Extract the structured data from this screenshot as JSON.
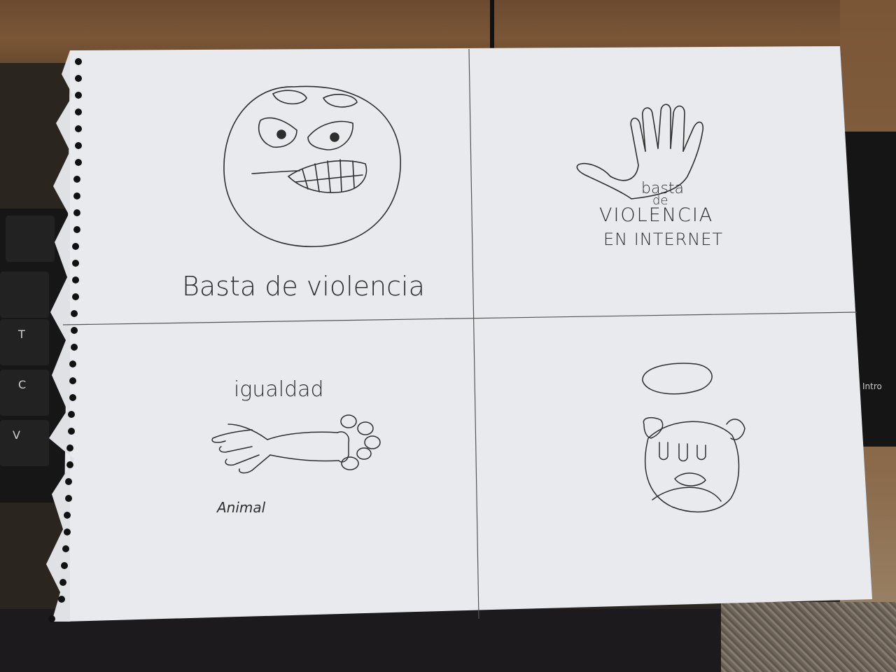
{
  "scene": {
    "description_colors": {
      "paper": "#e9ebee",
      "ink": "#2e2e2e",
      "desk": "#7a5636",
      "keyboard": "#161616"
    }
  },
  "keyboard": {
    "left_keys": [
      "T",
      "C",
      "V"
    ],
    "right_key": "Intro"
  },
  "panels": {
    "top_left": {
      "caption": "Basta de violencia",
      "icon": "angry-face-icon"
    },
    "top_right": {
      "line1": "basta",
      "line2": "de",
      "line3": "VIOLENCIA",
      "line4": "EN INTERNET",
      "icon": "raised-hand-icon"
    },
    "bottom_left": {
      "caption_top": "igualdad",
      "caption_bottom": "Animal",
      "icon": "hand-and-paw-icon"
    },
    "bottom_right": {
      "icon": "dog-with-halo-icon"
    }
  }
}
